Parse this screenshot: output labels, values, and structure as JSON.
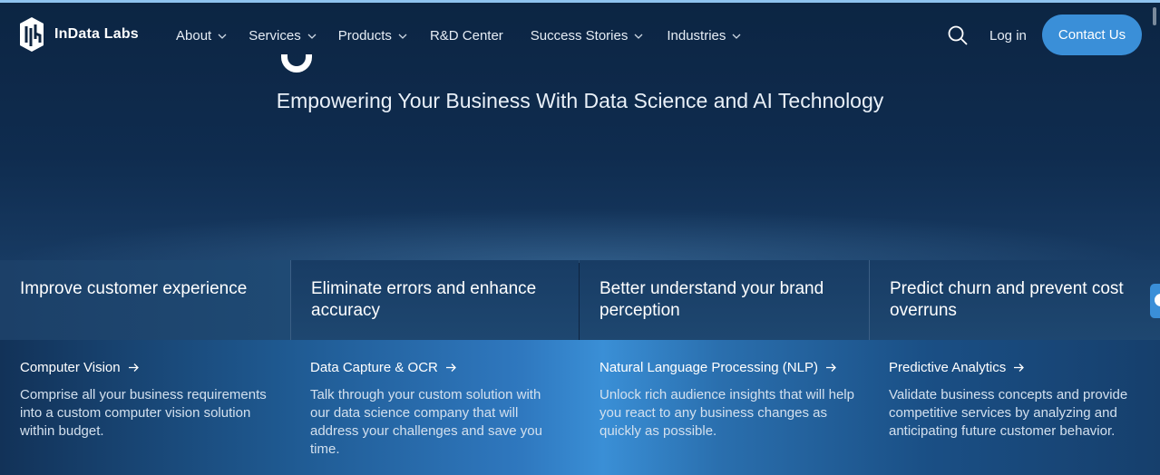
{
  "brand": {
    "name": "InData Labs"
  },
  "nav": {
    "items": [
      {
        "label": "About",
        "dropdown": true
      },
      {
        "label": "Services",
        "dropdown": true
      },
      {
        "label": "Products",
        "dropdown": true
      },
      {
        "label": "R&D Center",
        "dropdown": false
      },
      {
        "label": "Success Stories",
        "dropdown": true
      },
      {
        "label": "Industries",
        "dropdown": true
      }
    ],
    "login": "Log in",
    "contact": "Contact Us"
  },
  "hero": {
    "subtitle": "Empowering Your Business With Data Science and AI Technology"
  },
  "cards": [
    {
      "title": "Improve customer experience",
      "link": "Computer Vision",
      "description": "Comprise all your business requirements into a custom computer vision solution within budget."
    },
    {
      "title": "Eliminate errors and enhance accuracy",
      "link": "Data Capture & OCR",
      "description": "Talk through your custom solution with our data science company that will address your challenges and save you time."
    },
    {
      "title": "Better understand your brand perception",
      "link": "Natural Language Processing (NLP)",
      "description": "Unlock rich audience insights that will help you react to any business changes as quickly as possible."
    },
    {
      "title": "Predict churn and prevent cost overruns",
      "link": "Predictive Analytics",
      "description": "Validate business concepts and provide competitive services by analyzing and anticipating future customer behavior."
    }
  ],
  "colors": {
    "accent": "#3a8fd8",
    "background": "#0e2440"
  },
  "icons": {
    "search": "search-icon",
    "arrow": "arrow-right-icon",
    "chevron": "chevron-down-icon"
  }
}
